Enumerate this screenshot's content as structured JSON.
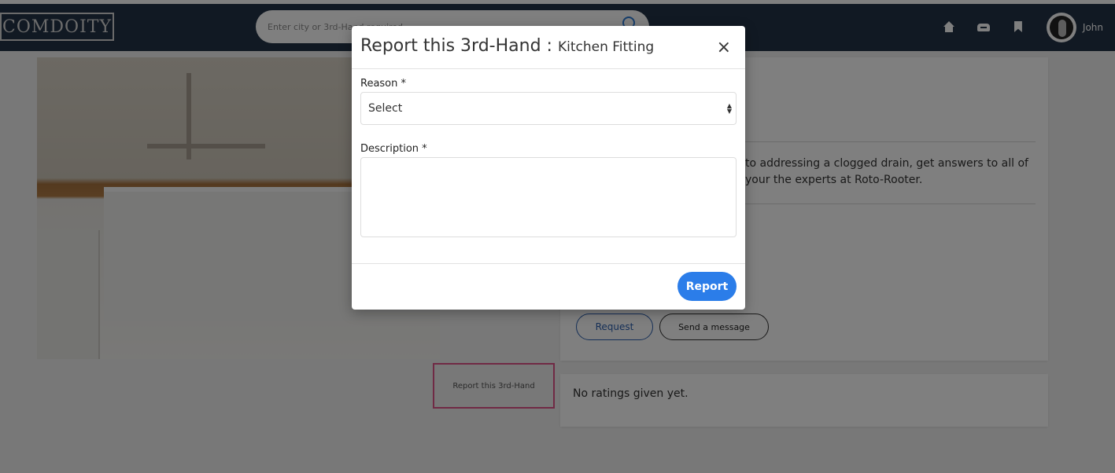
{
  "header": {
    "logo": "COMDOITY",
    "search_placeholder": "Enter city or 3rd-Hand required",
    "username": "John"
  },
  "listing": {
    "description": "to addressing a clogged drain, get answers to all of your the experts at Roto-Rooter.",
    "request_label": "Request",
    "message_label": "Send a message",
    "report_link": "Report this 3rd-Hand",
    "ratings_text": "No ratings given yet."
  },
  "modal": {
    "title": "Report this 3rd-Hand : ",
    "subtitle": "Kitchen Fitting",
    "close": "×",
    "reason_label": "Reason *",
    "reason_value": "Select",
    "description_label": "Description *",
    "submit_label": "Report"
  },
  "colors": {
    "navbar": "#233347",
    "accent": "#2b7de9",
    "highlight": "#e0558a"
  }
}
